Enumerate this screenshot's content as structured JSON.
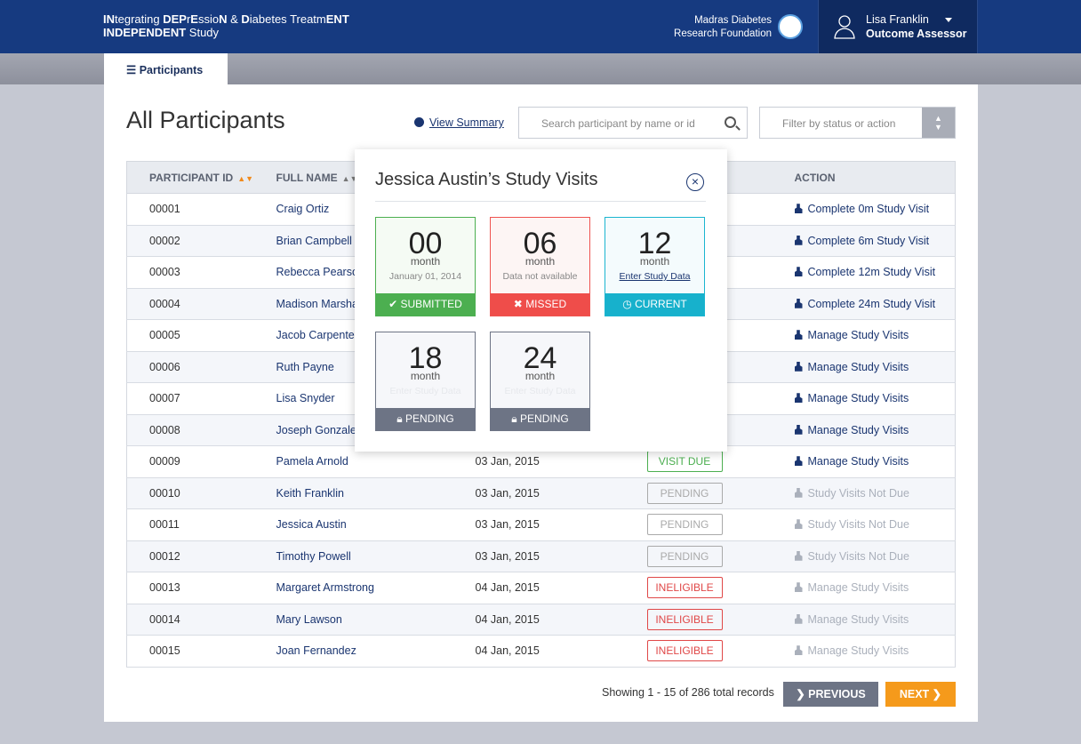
{
  "header": {
    "brand_line1_parts": [
      [
        "IN",
        true
      ],
      [
        "tegrating ",
        false
      ],
      [
        "DEP",
        true
      ],
      [
        "r",
        false
      ],
      [
        "E",
        true
      ],
      [
        "ssio",
        false
      ],
      [
        "N",
        true
      ],
      [
        " & ",
        false
      ],
      [
        "D",
        true
      ],
      [
        "iabetes Treatm",
        false
      ],
      [
        "ENT",
        true
      ]
    ],
    "brand_line2_bold": "INDEPENDENT",
    "brand_line2_rest": " Study",
    "org_line1": "Madras Diabetes",
    "org_line2": "Research Foundation",
    "user_name": "Lisa Franklin",
    "user_role": "Outcome Assessor"
  },
  "nav": {
    "tab_label": "Participants"
  },
  "page": {
    "title": "All Participants",
    "view_summary": "View Summary",
    "search_placeholder": "Search participant by name or id",
    "filter_placeholder": "Filter by status or action"
  },
  "table": {
    "headers": {
      "id": "PARTICIPANT ID",
      "name": "FULL NAME",
      "action": "ACTION"
    },
    "rows": [
      {
        "id": "00001",
        "name": "Craig Ortiz",
        "date": "",
        "status": "",
        "action": "Complete 0m Study Visit",
        "enabled": true
      },
      {
        "id": "00002",
        "name": "Brian Campbell",
        "date": "",
        "status": "",
        "action": "Complete 6m Study Visit",
        "enabled": true
      },
      {
        "id": "00003",
        "name": "Rebecca Pearson",
        "date": "",
        "status": "",
        "action": "Complete 12m Study Visit",
        "enabled": true
      },
      {
        "id": "00004",
        "name": "Madison Marshall",
        "date": "",
        "status": "",
        "action": "Complete 24m Study Visit",
        "enabled": true
      },
      {
        "id": "00005",
        "name": "Jacob Carpenter",
        "date": "",
        "status": "",
        "action": "Manage Study Visits",
        "enabled": true
      },
      {
        "id": "00006",
        "name": "Ruth Payne",
        "date": "",
        "status": "",
        "action": "Manage Study Visits",
        "enabled": true
      },
      {
        "id": "00007",
        "name": "Lisa Snyder",
        "date": "",
        "status": "",
        "action": "Manage Study Visits",
        "enabled": true
      },
      {
        "id": "00008",
        "name": "Joseph Gonzales",
        "date": "",
        "status": "",
        "action": "Manage Study Visits",
        "enabled": true
      },
      {
        "id": "00009",
        "name": "Pamela Arnold",
        "date": "03 Jan, 2015",
        "status": "VISIT DUE",
        "action": "Manage Study Visits",
        "enabled": true
      },
      {
        "id": "00010",
        "name": "Keith Franklin",
        "date": "03 Jan, 2015",
        "status": "PENDING",
        "action": "Study Visits Not Due",
        "enabled": false
      },
      {
        "id": "00011",
        "name": "Jessica Austin",
        "date": "03 Jan, 2015",
        "status": "PENDING",
        "action": "Study Visits Not Due",
        "enabled": false
      },
      {
        "id": "00012",
        "name": "Timothy Powell",
        "date": "03 Jan, 2015",
        "status": "PENDING",
        "action": "Study Visits Not Due",
        "enabled": false
      },
      {
        "id": "00013",
        "name": "Margaret Armstrong",
        "date": "04 Jan, 2015",
        "status": "INELIGIBLE",
        "action": "Manage Study Visits",
        "enabled": false
      },
      {
        "id": "00014",
        "name": "Mary Lawson",
        "date": "04 Jan, 2015",
        "status": "INELIGIBLE",
        "action": "Manage Study Visits",
        "enabled": false
      },
      {
        "id": "00015",
        "name": "Joan Fernandez",
        "date": "04 Jan, 2015",
        "status": "INELIGIBLE",
        "action": "Manage Study Visits",
        "enabled": false
      }
    ]
  },
  "pagination": {
    "summary": "Showing 1 - 15 of 286 total records",
    "previous": "PREVIOUS",
    "next": "NEXT"
  },
  "popup": {
    "title": "Jessica Austin’s Study Visits",
    "visits": [
      {
        "num": "00",
        "unit": "month",
        "detail": "January 01, 2014",
        "status": "SUBMITTED",
        "icon": "check-icon",
        "kind": "sub"
      },
      {
        "num": "06",
        "unit": "month",
        "detail": "Data not available",
        "status": "MISSED",
        "icon": "x-icon",
        "kind": "mis"
      },
      {
        "num": "12",
        "unit": "month",
        "detail": "Enter Study Data",
        "status": "CURRENT",
        "icon": "clock-icon",
        "kind": "cur"
      },
      {
        "num": "18",
        "unit": "month",
        "detail": "Enter Study Data",
        "status": "PENDING",
        "icon": "lock-icon",
        "kind": "pen"
      },
      {
        "num": "24",
        "unit": "month",
        "detail": "Enter Study Data",
        "status": "PENDING",
        "icon": "lock-icon",
        "kind": "pen"
      }
    ]
  },
  "colors": {
    "header": "#163a80",
    "accent": "#f59a1b",
    "submitted": "#4caf50",
    "missed": "#ef4d4a",
    "current": "#17b1cc",
    "pending": "#6d7485"
  }
}
